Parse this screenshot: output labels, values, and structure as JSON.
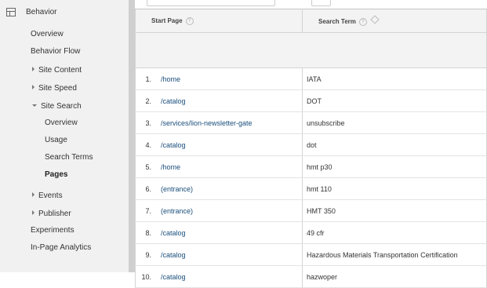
{
  "sidebar": {
    "section_title": "Behavior",
    "section_icon": "layout-icon",
    "items": [
      {
        "label": "Overview",
        "kind": "top"
      },
      {
        "label": "Behavior Flow",
        "kind": "top"
      },
      {
        "label": "Site Content",
        "kind": "group",
        "arrow": "right"
      },
      {
        "label": "Site Speed",
        "kind": "group",
        "arrow": "right"
      },
      {
        "label": "Site Search",
        "kind": "group",
        "arrow": "down"
      },
      {
        "label": "Overview",
        "kind": "sub"
      },
      {
        "label": "Usage",
        "kind": "sub"
      },
      {
        "label": "Search Terms",
        "kind": "sub"
      },
      {
        "label": "Pages",
        "kind": "sub",
        "active": true
      },
      {
        "label": "Events",
        "kind": "group",
        "arrow": "right"
      },
      {
        "label": "Publisher",
        "kind": "group",
        "arrow": "right"
      },
      {
        "label": "Experiments",
        "kind": "top"
      },
      {
        "label": "In-Page Analytics",
        "kind": "top"
      }
    ]
  },
  "table": {
    "columns": [
      {
        "label": "Start Page",
        "help": "?"
      },
      {
        "label": "Search Term",
        "help": "?"
      }
    ],
    "rows": [
      {
        "index": "1.",
        "page": "/home",
        "term": "IATA"
      },
      {
        "index": "2.",
        "page": "/catalog",
        "term": "DOT"
      },
      {
        "index": "3.",
        "page": "/services/lion-newsletter-gate",
        "term": "unsubscribe"
      },
      {
        "index": "4.",
        "page": "/catalog",
        "term": "dot"
      },
      {
        "index": "5.",
        "page": "/home",
        "term": "hmt p30"
      },
      {
        "index": "6.",
        "page": "(entrance)",
        "term": "hmt 110"
      },
      {
        "index": "7.",
        "page": "(entrance)",
        "term": "HMT 350"
      },
      {
        "index": "8.",
        "page": "/catalog",
        "term": "49 cfr"
      },
      {
        "index": "9.",
        "page": "/catalog",
        "term": "Hazardous Materials Transportation Certification"
      },
      {
        "index": "10.",
        "page": "/catalog",
        "term": "hazwoper"
      }
    ]
  }
}
